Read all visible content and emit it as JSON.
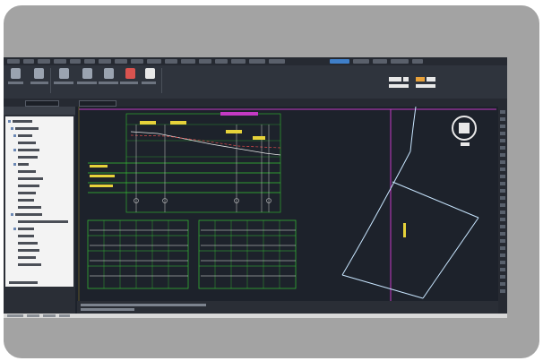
{
  "window": {
    "title": ""
  },
  "ribbon": {
    "tabs": [
      "",
      "",
      "",
      "",
      "",
      "",
      "",
      "",
      "",
      "",
      "",
      "",
      "",
      "",
      "",
      "",
      "",
      "",
      "",
      "",
      "",
      ""
    ],
    "active_tab_index": 17,
    "buttons": [
      "",
      "",
      "",
      "",
      "",
      "",
      "",
      "",
      "",
      ""
    ]
  },
  "quick_access": {
    "view_selector": "",
    "style_selector": ""
  },
  "navigator": {
    "title": "",
    "tree_items": [
      "",
      "",
      "",
      "",
      "",
      "",
      "",
      "",
      "",
      "",
      "",
      "",
      "",
      "",
      "",
      "",
      "",
      "",
      "",
      "",
      "",
      ""
    ]
  },
  "drawing": {
    "profile_title": "",
    "profile_band_labels": [
      "",
      "",
      ""
    ],
    "profile_callouts": [
      "",
      "",
      "",
      "",
      ""
    ],
    "section_sheets": 2,
    "plan_label": ""
  },
  "command_line": {
    "lines": [
      "",
      ""
    ]
  },
  "status_bar": {
    "items": [
      "",
      "",
      "",
      ""
    ]
  },
  "colors": {
    "card": "#a3a3a3",
    "model_space": "#1d222b",
    "ribbon": "#2f343d",
    "active_tab": "#3f7fc9",
    "profile_grid": "#36c236",
    "callout": "#e6d23a",
    "centerline": "#d23ad2",
    "alignment": "#c8e6ff"
  },
  "icons": [
    "compass-icon",
    "navcube-icon",
    "tree-expand-icon",
    "ribbon-tool-icon"
  ]
}
